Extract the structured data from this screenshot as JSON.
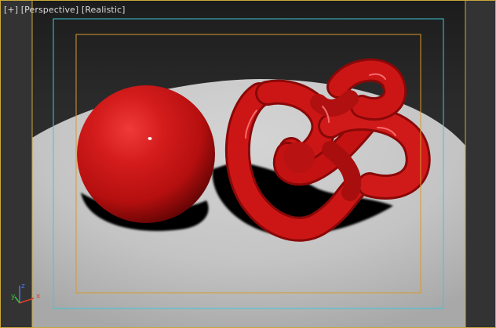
{
  "viewport": {
    "labels": {
      "plus": "[+]",
      "view": "[Perspective]",
      "shading": "[Realistic]"
    },
    "gizmo": {
      "x_label": "x",
      "y_label": "y",
      "z_label": "z",
      "x_color": "#e0402a",
      "y_color": "#40c040",
      "z_color": "#4a78e8"
    },
    "colors": {
      "viewport_border": "#c8a83c",
      "safe_frame_outer": "#3cc8d8",
      "safe_frame_inner": "#d89a2a",
      "object_color": "#cc1010",
      "floor_color": "#c6c6c6",
      "background_top": "#202020",
      "background_bottom": "#3a3a3a"
    },
    "objects": [
      {
        "name": "Sphere",
        "shape": "sphere-icon"
      },
      {
        "name": "Torus Knot",
        "shape": "torus-knot-icon"
      }
    ]
  }
}
